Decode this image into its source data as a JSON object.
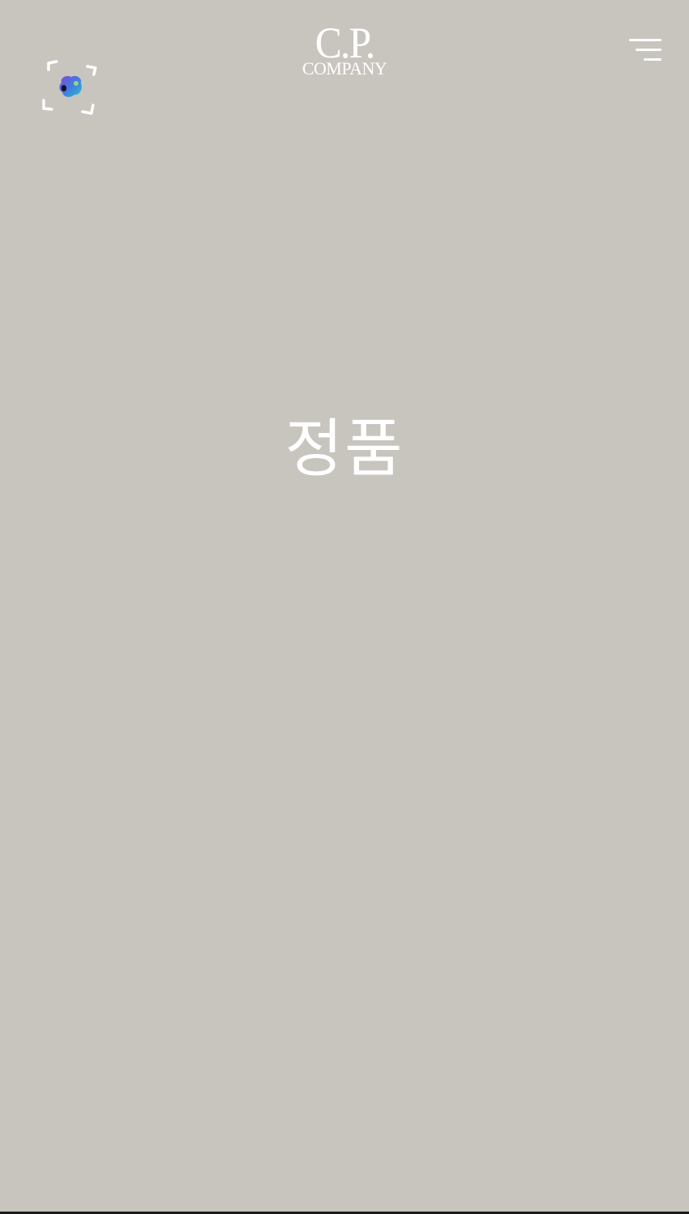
{
  "header": {
    "logo_top": "C.P.",
    "logo_bottom": "COMPANY",
    "ar_icon": "ar-scan-icon",
    "menu_icon": "hamburger-menu-icon"
  },
  "main": {
    "title": "정품"
  },
  "colors": {
    "background": "#c8c5bf",
    "foreground": "#ffffff"
  }
}
